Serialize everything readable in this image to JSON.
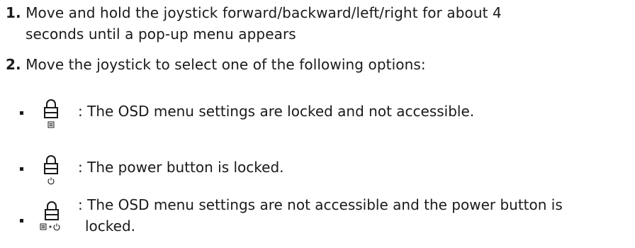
{
  "steps": [
    {
      "number": "1.",
      "line1": "Move and hold the joystick forward/backward/left/right for about 4",
      "line2": "seconds until a pop-up menu appears"
    },
    {
      "number": "2.",
      "text": "Move the joystick to select one of the following options:"
    }
  ],
  "options": [
    {
      "icon": "lock-menu-icon",
      "text": ": The OSD menu settings are locked and not accessible."
    },
    {
      "icon": "lock-power-icon",
      "text": ": The power button is locked."
    },
    {
      "icon": "lock-menu-power-icon",
      "line1": ": The OSD menu settings are not accessible and the power button is",
      "line2": "locked."
    }
  ]
}
